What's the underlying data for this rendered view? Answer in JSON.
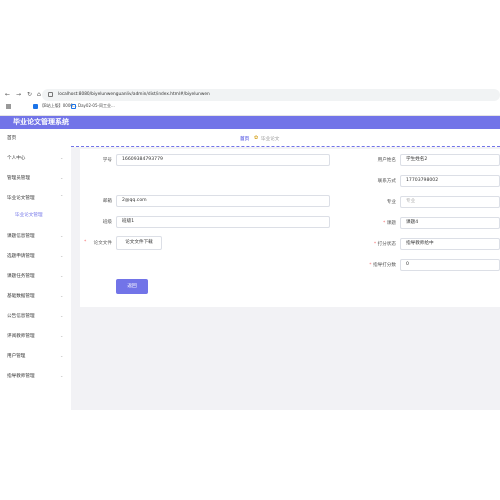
{
  "browser": {
    "url": "localhost:8080/biyelunwenguanliv/admin/dist/index.html#/biyelunwen",
    "bookmarks": [
      "【B站上版】0000...",
      "Day02-05-同工业..."
    ]
  },
  "app": {
    "title": "毕业论文管理系统"
  },
  "sidebar": {
    "items": [
      {
        "label": "首页"
      },
      {
        "label": "个人中心"
      },
      {
        "label": "管理员管理"
      },
      {
        "label": "毕业论文管理"
      },
      {
        "label": "毕业论文管理"
      },
      {
        "label": "课题信息管理"
      },
      {
        "label": "选题申请管理"
      },
      {
        "label": "课题任务管理"
      },
      {
        "label": "基础数据管理"
      },
      {
        "label": "公告信息管理"
      },
      {
        "label": "评阅教师管理"
      },
      {
        "label": "用户管理"
      },
      {
        "label": "指导教师管理"
      }
    ]
  },
  "breadcrumb": {
    "home": "首页",
    "current": "毕业论文"
  },
  "form": {
    "left": [
      {
        "label": "学号",
        "value": "16609384793779"
      },
      {
        "label": "邮箱",
        "value": "2@qq.com"
      },
      {
        "label": "班级",
        "value": "班级1"
      },
      {
        "label": "论文文件",
        "value": "论文文件下载",
        "required": "*"
      }
    ],
    "right": [
      {
        "label": "用户姓名",
        "value": "学生姓名2"
      },
      {
        "label": "联系方式",
        "value": "17703798002"
      },
      {
        "label": "专业",
        "value": "专业"
      },
      {
        "label": "课题",
        "value": "课题4",
        "required": "*"
      },
      {
        "label": "打分状态",
        "value": "指导教师给中",
        "required": "*"
      },
      {
        "label": "指导打分数",
        "value": "0",
        "required": "*"
      }
    ],
    "back_button": "返回"
  },
  "colors": {
    "accent": "#7274e8",
    "background": "#f2f2f5"
  }
}
